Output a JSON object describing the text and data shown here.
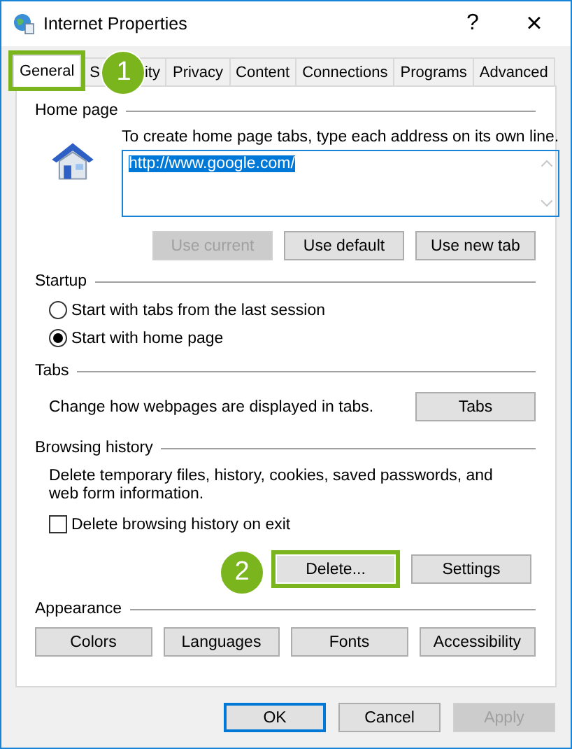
{
  "window": {
    "title": "Internet Properties",
    "help": "?",
    "close": "×"
  },
  "tabs": [
    {
      "label": "General",
      "selected": true,
      "highlighted": true,
      "callout": "1"
    },
    {
      "label_parts": [
        "S",
        "ity"
      ],
      "selected": false,
      "highlighted": false
    },
    {
      "label": "Privacy",
      "selected": false,
      "highlighted": false
    },
    {
      "label": "Content",
      "selected": false,
      "highlighted": false
    },
    {
      "label": "Connections",
      "selected": false,
      "highlighted": false
    },
    {
      "label": "Programs",
      "selected": false,
      "highlighted": false
    },
    {
      "label": "Advanced",
      "selected": false,
      "highlighted": false
    }
  ],
  "home_page": {
    "heading": "Home page",
    "description": "To create home page tabs, type each address on its own line.",
    "addresses": [
      "http://www.google.com/"
    ],
    "buttons": [
      {
        "label": "Use current",
        "disabled": true
      },
      {
        "label": "Use default",
        "disabled": false
      },
      {
        "label": "Use new tab",
        "disabled": false
      }
    ]
  },
  "startup": {
    "heading": "Startup",
    "options": [
      {
        "label": "Start with tabs from the last session",
        "selected": false
      },
      {
        "label": "Start with home page",
        "selected": true
      }
    ]
  },
  "tabs_section": {
    "heading": "Tabs",
    "description": "Change how webpages are displayed in tabs.",
    "button": "Tabs"
  },
  "browsing_history": {
    "heading": "Browsing history",
    "description": "Delete temporary files, history, cookies, saved passwords, and web form information.",
    "checkbox": {
      "label": "Delete browsing history on exit",
      "checked": false
    },
    "buttons": [
      {
        "label": "Delete...",
        "highlighted": true,
        "callout": "2"
      },
      {
        "label": "Settings",
        "highlighted": false
      }
    ]
  },
  "appearance": {
    "heading": "Appearance",
    "buttons": [
      "Colors",
      "Languages",
      "Fonts",
      "Accessibility"
    ]
  },
  "footer": [
    {
      "label": "OK",
      "default": true,
      "disabled": false
    },
    {
      "label": "Cancel",
      "default": false,
      "disabled": false
    },
    {
      "label": "Apply",
      "default": false,
      "disabled": true
    }
  ]
}
